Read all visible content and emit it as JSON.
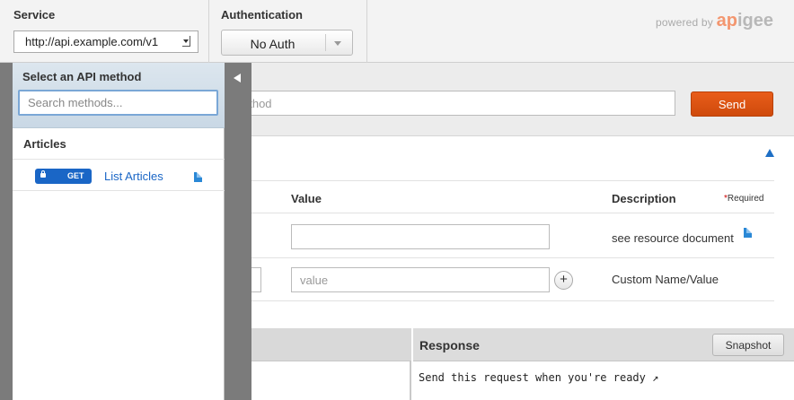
{
  "header": {
    "service_label": "Service",
    "service_value": "http://api.example.com/v1",
    "auth_label": "Authentication",
    "auth_value": "No Auth",
    "powered_by": "powered by",
    "brand_part1": "ap",
    "brand_part2": "i",
    "brand_part3": "gee"
  },
  "request": {
    "method_placeholder": "ethod",
    "send_label": "Send"
  },
  "params": {
    "headers": {
      "value": "Value",
      "description": "Description",
      "required_star": "*",
      "required": "Required"
    },
    "rows": [
      {
        "value": "",
        "description": "see resource document"
      },
      {
        "value_placeholder": "value",
        "description": "Custom Name/Value"
      }
    ],
    "add_label": "+"
  },
  "response": {
    "title": "Response",
    "snapshot_label": "Snapshot",
    "body": "Send this request when you're ready ↗"
  },
  "sidebar": {
    "title": "Select an API method",
    "search_placeholder": "Search methods...",
    "group": "Articles",
    "items": [
      {
        "verb": "GET",
        "label": "List Articles"
      }
    ]
  },
  "colors": {
    "accent": "#1a66c6",
    "send": "#e0561a",
    "brand": "#f3966f"
  }
}
